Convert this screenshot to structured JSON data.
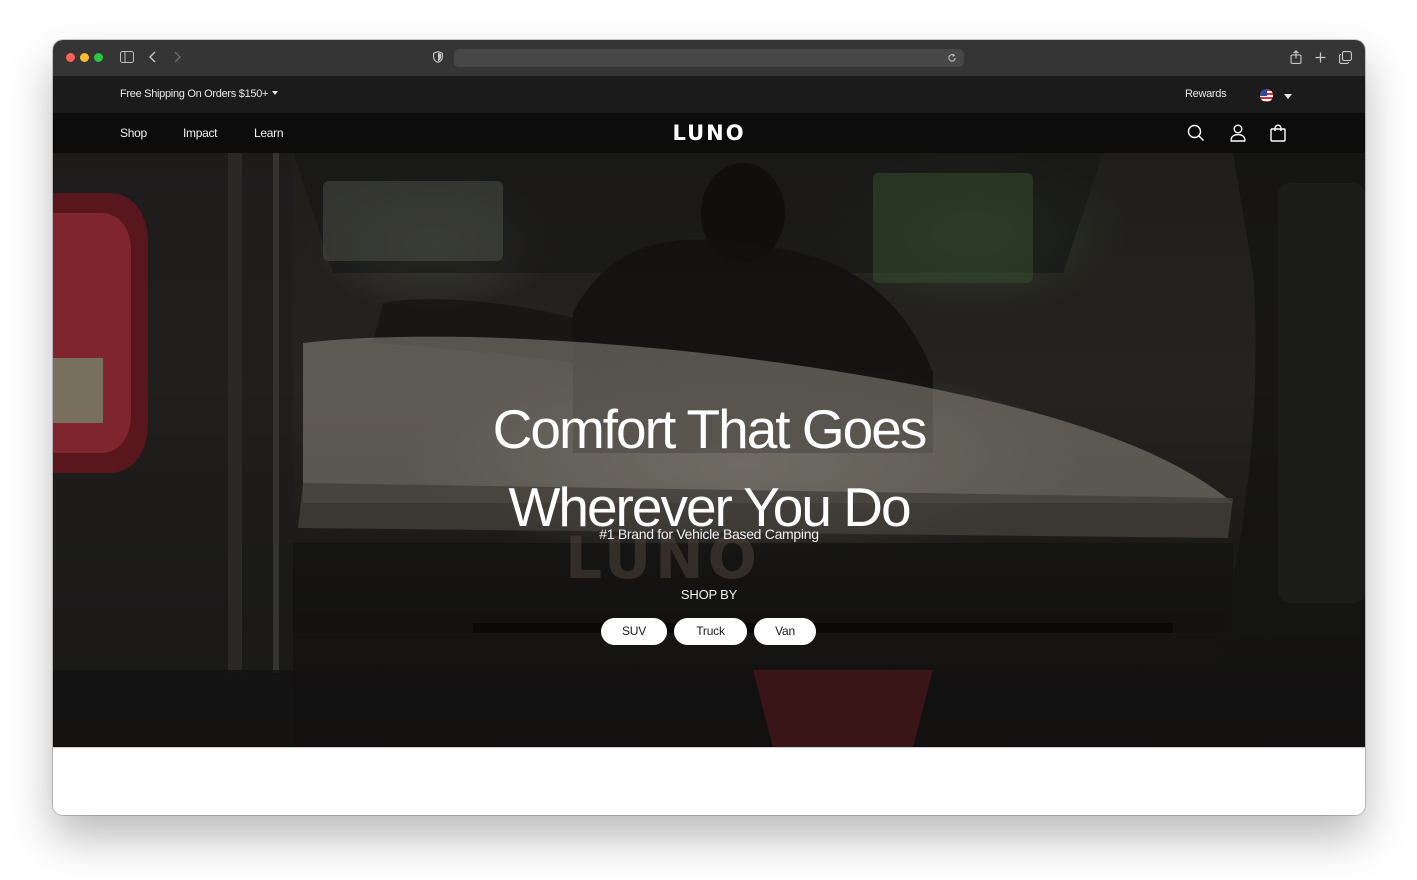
{
  "browser": {
    "icons": [
      "sidebar-icon",
      "back-arrow-icon",
      "forward-arrow-icon",
      "shield-icon",
      "reload-icon",
      "share-icon",
      "plus-icon",
      "tabs-icon"
    ],
    "address_value": ""
  },
  "announcement": {
    "shipping_text": "Free Shipping On Orders $150+",
    "rewards_label": "Rewards",
    "country": "US"
  },
  "nav": {
    "links": [
      "Shop",
      "Impact",
      "Learn"
    ],
    "logo": "LUNO",
    "icons": [
      "search-icon",
      "account-icon",
      "cart-icon"
    ]
  },
  "hero": {
    "title_line1": "Comfort That Goes",
    "title_line2": "Wherever You Do",
    "subtitle": "#1 Brand for Vehicle Based Camping",
    "shop_by_label": "SHOP BY",
    "buttons": [
      "SUV",
      "Truck",
      "Van"
    ]
  },
  "colors": {
    "chrome": "#353535",
    "announcement_bg": "#1b1b1b",
    "nav_bg": "#0c0c0c",
    "pill_bg": "#ffffff",
    "hero_text": "#ffffff"
  }
}
